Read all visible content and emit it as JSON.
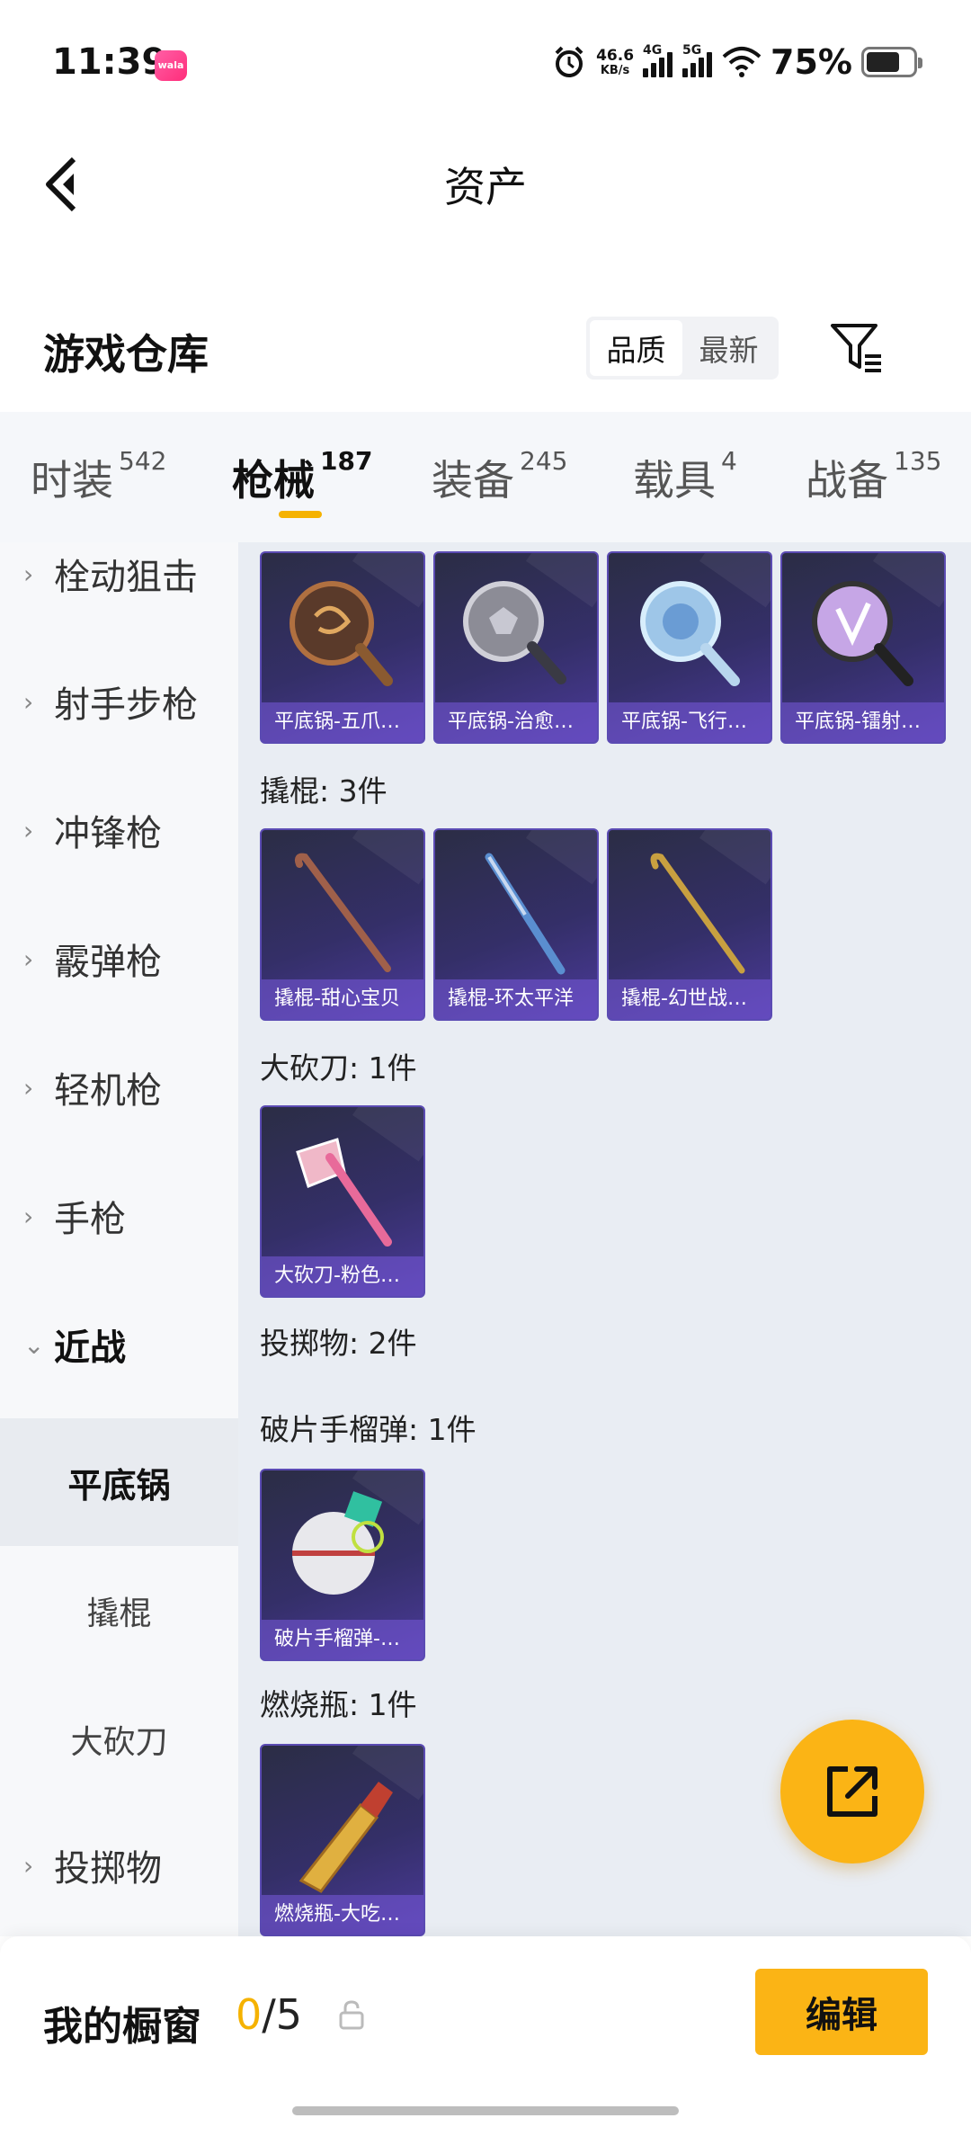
{
  "status_bar": {
    "time": "11:39",
    "app_badge": "wala",
    "net_speed_value": "46.6",
    "net_speed_unit": "KB/s",
    "signal_1": "4G",
    "signal_2": "5G",
    "battery_percent": "75%"
  },
  "header": {
    "title": "资产"
  },
  "warehouse": {
    "title": "游戏仓库",
    "sort_options": [
      "品质",
      "最新"
    ],
    "active_sort": "品质"
  },
  "tabs": [
    {
      "label": "时装",
      "count": "542"
    },
    {
      "label": "枪械",
      "count": "187",
      "active": true
    },
    {
      "label": "装备",
      "count": "245"
    },
    {
      "label": "载具",
      "count": "4"
    },
    {
      "label": "战备",
      "count": "135"
    }
  ],
  "sidebar": {
    "items": [
      "栓动狙击",
      "射手步枪",
      "冲锋枪",
      "霰弹枪",
      "轻机枪",
      "手枪",
      "近战"
    ],
    "subitems": [
      "平底锅",
      "撬棍",
      "大砍刀"
    ],
    "active_subitem": "平底锅",
    "after": [
      "投掷物"
    ]
  },
  "content": {
    "pan_items": [
      "平底锅-五爪…",
      "平底锅-治愈…",
      "平底锅-飞行…",
      "平底锅-镭射…"
    ],
    "crowbar_label": "撬棍: 3件",
    "crowbar_items": [
      "撬棍-甜心宝贝",
      "撬棍-环太平洋",
      "撬棍-幻世战…"
    ],
    "machete_label": "大砍刀: 1件",
    "machete_items": [
      "大砍刀-粉色…"
    ],
    "throwable_label": "投掷物: 2件",
    "grenade_label": "破片手榴弹: 1件",
    "grenade_items": [
      "破片手榴弹-…"
    ],
    "molotov_label": "燃烧瓶: 1件",
    "molotov_items": [
      "燃烧瓶-大吃…"
    ]
  },
  "bottom": {
    "showcase_label": "我的橱窗",
    "showcase_current": "0",
    "showcase_total": "/5",
    "edit_label": "编辑"
  },
  "colors": {
    "accent": "#fbb415",
    "card_bg": "#342f68",
    "card_border": "#5b4bb3"
  }
}
